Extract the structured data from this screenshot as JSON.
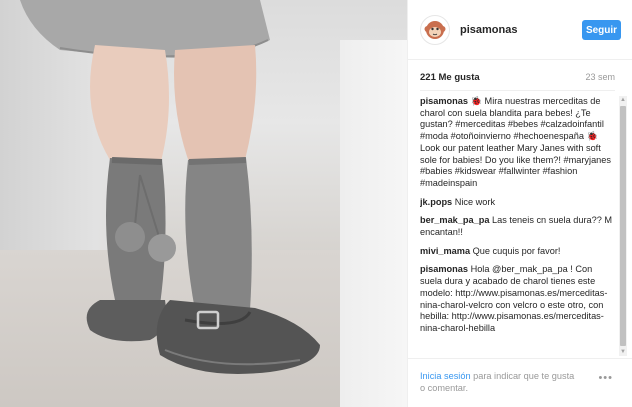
{
  "post": {
    "username": "pisamonas",
    "follow_label": "Seguir",
    "likes": "221 Me gusta",
    "age": "23 sem",
    "photo_description_icon": "photo-baby-shoes"
  },
  "comments": [
    {
      "user": "pisamonas",
      "text": "🐞 Mira nuestras merceditas de charol con suela blandita para bebes! ¿Te gustan? #merceditas #bebes #calzadoinfantil #moda #otoñoinvierno #hechoenespaña 🐞 Look our patent leather Mary Janes with soft sole for babies! Do you like them?! #maryjanes #babies #kidswear #fallwinter #fashion #madeinspain"
    },
    {
      "user": "jk.pops",
      "text": "Nice work"
    },
    {
      "user": "ber_mak_pa_pa",
      "text": "Las teneis cn suela dura?? M encantan!!"
    },
    {
      "user": "mivi_mama",
      "text": "Que cuquis por favor!"
    },
    {
      "user": "pisamonas",
      "text": "Hola @ber_mak_pa_pa ! Con suela dura y acabado de charol tienes este modelo: http://www.pisamonas.es/merceditas-nina-charol-velcro con velcro o este otro, con hebilla: http://www.pisamonas.es/merceditas-nina-charol-hebilla"
    }
  ],
  "footer": {
    "login_label": "Inicia sesión",
    "login_suffix": " para indicar que te gusta o comentar.",
    "more_icon": "ellipsis-icon"
  },
  "colors": {
    "accent": "#3897f0",
    "text": "#262626",
    "muted": "#999999",
    "border": "#efefef"
  }
}
